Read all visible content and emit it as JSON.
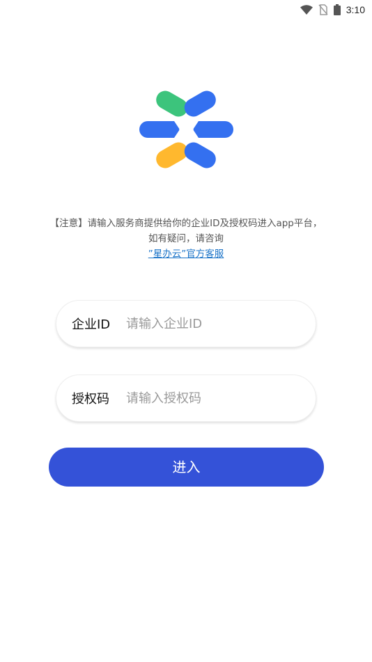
{
  "status_bar": {
    "time": "3:10",
    "icons": [
      "wifi-icon",
      "no-sim-icon",
      "battery-icon"
    ]
  },
  "logo": {
    "name": "star-logo-icon",
    "colors": {
      "green": "#3cc47c",
      "blue": "#3470f0",
      "yellow": "#ffb82e"
    }
  },
  "notice": {
    "line1": "【注意】请输入服务商提供给你的企业ID及授权码进入app平台，",
    "line2": "如有疑问，请咨询",
    "link": "”星办云”官方客服"
  },
  "form": {
    "enterprise_id": {
      "label": "企业ID",
      "placeholder": "请输入企业ID",
      "value": ""
    },
    "auth_code": {
      "label": "授权码",
      "placeholder": "请输入授权码",
      "value": ""
    },
    "submit_label": "进入"
  },
  "colors": {
    "accent": "#3452d8",
    "link": "#1a73c8"
  }
}
